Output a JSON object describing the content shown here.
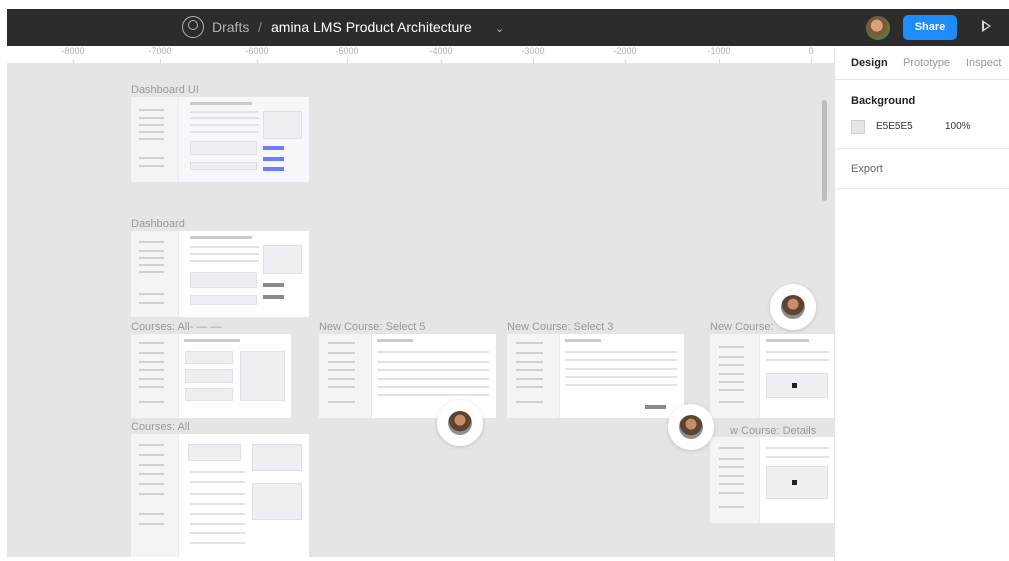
{
  "app": {
    "breadcrumb_drafts": "Drafts",
    "breadcrumb_separator": "/",
    "file_name": "amina LMS Product Architecture",
    "file_menu_chevron": "⌄",
    "share_label": "Share",
    "icons": {
      "logo": "figma-home-icon",
      "play": "play-icon",
      "avatar": "user-avatar"
    },
    "colors": {
      "topbar": "#2c2c2c",
      "share": "#1e8cff",
      "canvas": "#e5e5e5"
    }
  },
  "ruler": {
    "ticks": [
      "-8000",
      "-7000",
      "-6000",
      "-5000",
      "-4000",
      "-3000",
      "-2000",
      "-1000",
      "0"
    ]
  },
  "canvas": {
    "frames": [
      {
        "label": "Dashboard UI"
      },
      {
        "label": "Dashboard"
      },
      {
        "label": "Courses: All- — —"
      },
      {
        "label": "New Course: Select 5"
      },
      {
        "label": "New Course: Select 3"
      },
      {
        "label": "New Course:"
      },
      {
        "label": "Courses: All"
      },
      {
        "label": "w Course: Details"
      }
    ]
  },
  "panel": {
    "tabs": [
      "Design",
      "Prototype",
      "Inspect"
    ],
    "active_tab": "Design",
    "background_title": "Background",
    "background_hex": "E5E5E5",
    "background_opacity": "100%",
    "export_label": "Export"
  }
}
